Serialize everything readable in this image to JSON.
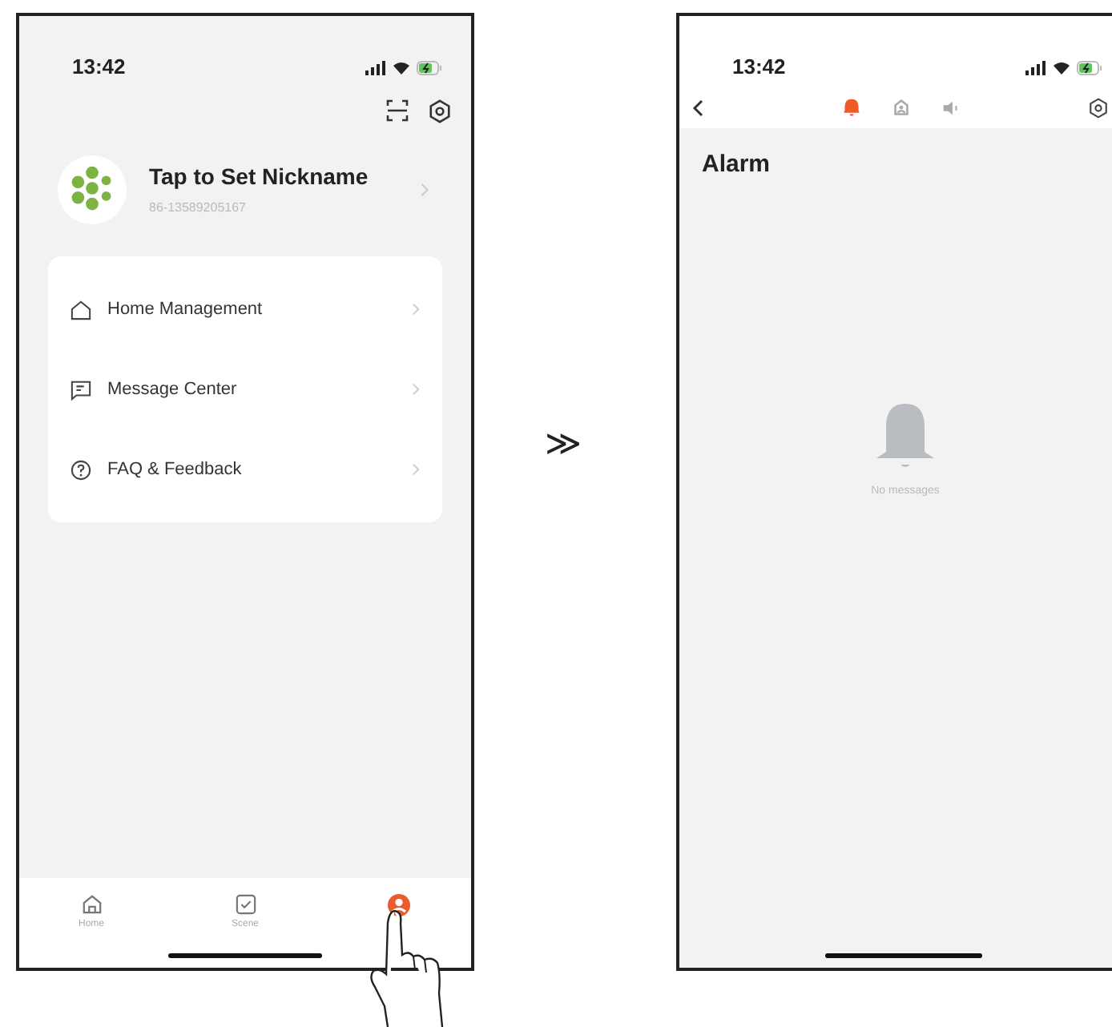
{
  "screens": [
    {
      "kind": "profile",
      "status_bar": {
        "time": "13:42"
      },
      "profile": {
        "nickname": "Tap to Set Nickname",
        "account": "86-13589205167"
      },
      "menu": [
        {
          "label": "Home Management"
        },
        {
          "label": "Message Center"
        },
        {
          "label": "FAQ & Feedback"
        }
      ],
      "tabs": [
        {
          "label": "Home",
          "selected": false
        },
        {
          "label": "Scene",
          "selected": false
        },
        {
          "selected": true
        }
      ]
    },
    {
      "kind": "messages",
      "status_bar": {
        "time": "13:42"
      },
      "category_tabs": [
        {
          "selected": true
        },
        {
          "selected": false
        },
        {
          "selected": false
        }
      ],
      "title": "Alarm",
      "empty_text": "No messages"
    }
  ],
  "transition_mark": "≫"
}
